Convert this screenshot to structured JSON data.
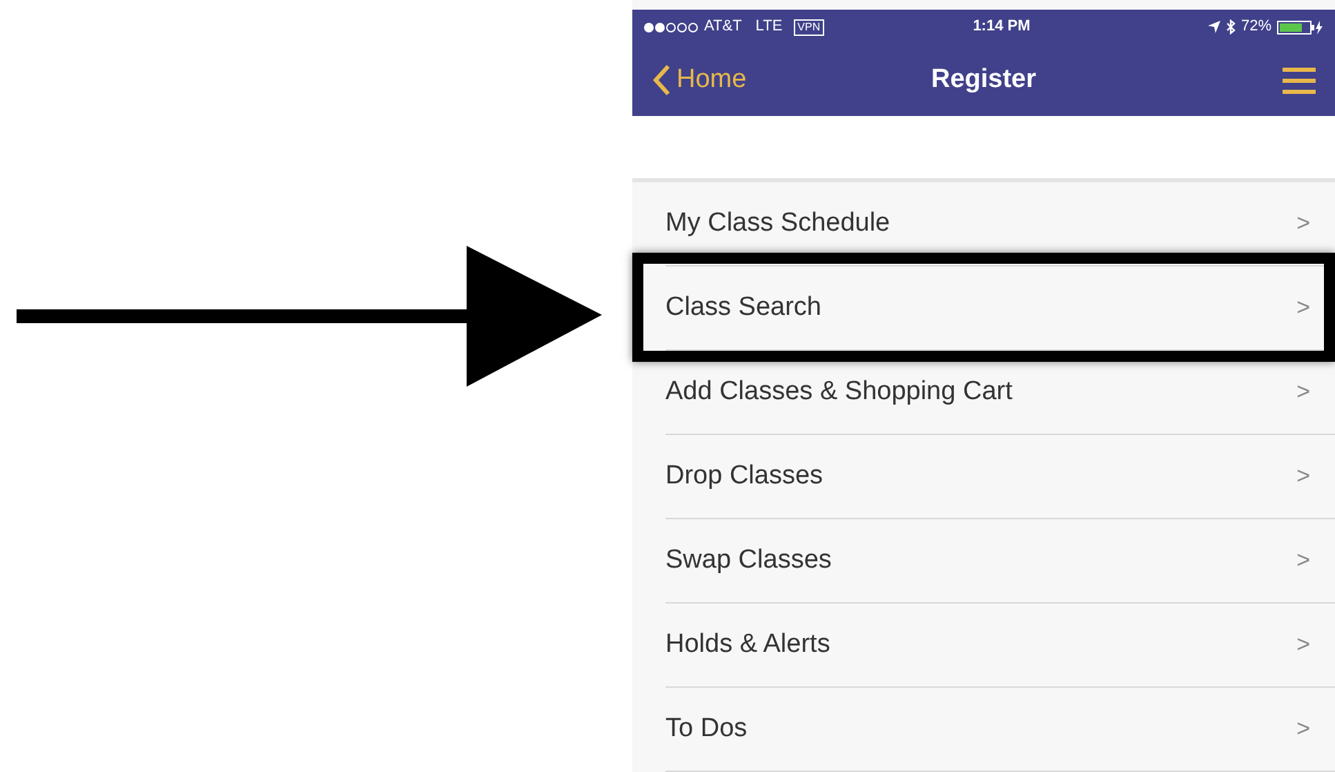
{
  "status_bar": {
    "carrier": "AT&T",
    "network": "LTE",
    "vpn": "VPN",
    "time": "1:14 PM",
    "battery": "72%"
  },
  "nav_bar": {
    "back": "Home",
    "title": "Register"
  },
  "menu": [
    {
      "label": "My Class Schedule",
      "chevron": ">",
      "highlighted": false
    },
    {
      "label": "Class Search",
      "chevron": ">",
      "highlighted": true
    },
    {
      "label": "Add Classes & Shopping Cart",
      "chevron": ">",
      "highlighted": false
    },
    {
      "label": "Drop Classes",
      "chevron": ">",
      "highlighted": false
    },
    {
      "label": "Swap Classes",
      "chevron": ">",
      "highlighted": false
    },
    {
      "label": "Holds & Alerts",
      "chevron": ">",
      "highlighted": false
    },
    {
      "label": "To Dos",
      "chevron": ">",
      "highlighted": false
    }
  ]
}
